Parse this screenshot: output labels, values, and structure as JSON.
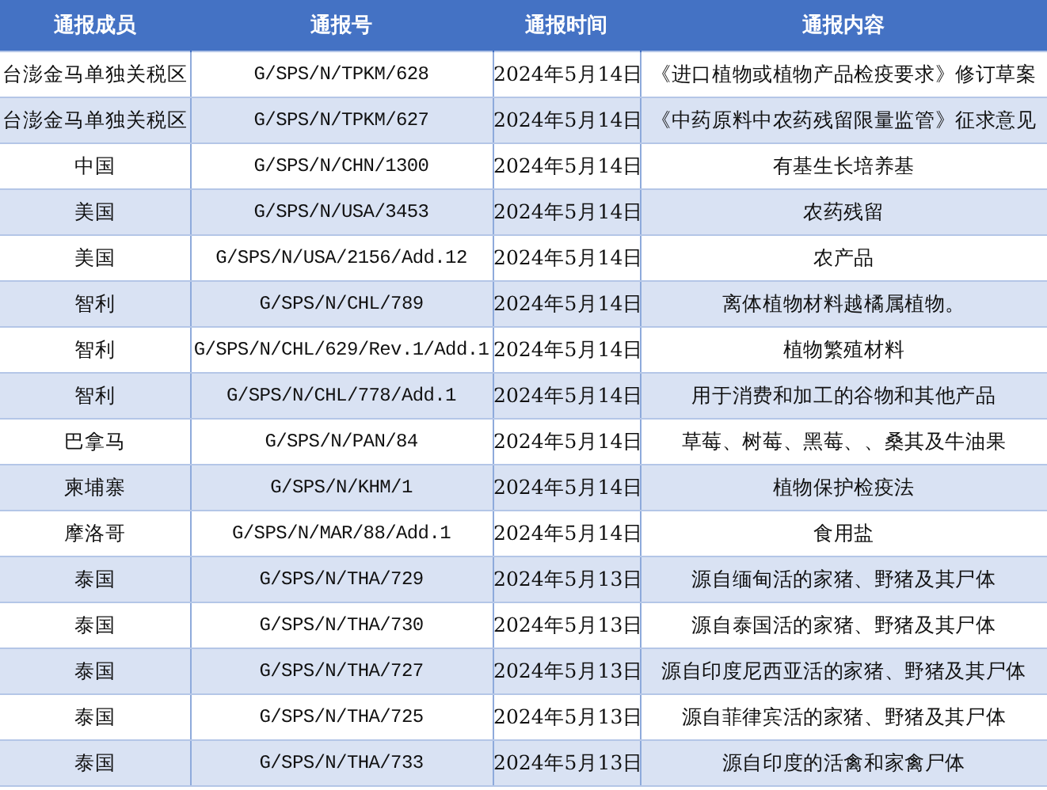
{
  "table": {
    "columns": [
      "通报成员",
      "通报号",
      "通报时间",
      "通报内容"
    ],
    "rows": [
      [
        "台澎金马单独关税区",
        "G/SPS/N/TPKM/628",
        "2024年5月14日",
        "《进口植物或植物产品检疫要求》修订草案"
      ],
      [
        "台澎金马单独关税区",
        "G/SPS/N/TPKM/627",
        "2024年5月14日",
        "《中药原料中农药残留限量监管》征求意见"
      ],
      [
        "中国",
        "G/SPS/N/CHN/1300",
        "2024年5月14日",
        "有基生长培养基"
      ],
      [
        "美国",
        "G/SPS/N/USA/3453",
        "2024年5月14日",
        "农药残留"
      ],
      [
        "美国",
        "G/SPS/N/USA/2156/Add.12",
        "2024年5月14日",
        "农产品"
      ],
      [
        "智利",
        "G/SPS/N/CHL/789",
        "2024年5月14日",
        "离体植物材料越橘属植物。"
      ],
      [
        "智利",
        "G/SPS/N/CHL/629/Rev.1/Add.1",
        "2024年5月14日",
        "植物繁殖材料"
      ],
      [
        "智利",
        "G/SPS/N/CHL/778/Add.1",
        "2024年5月14日",
        "用于消费和加工的谷物和其他产品"
      ],
      [
        "巴拿马",
        "G/SPS/N/PAN/84",
        "2024年5月14日",
        "草莓、树莓、黑莓、、桑其及牛油果"
      ],
      [
        "柬埔寨",
        "G/SPS/N/KHM/1",
        "2024年5月14日",
        "植物保护检疫法"
      ],
      [
        "摩洛哥",
        "G/SPS/N/MAR/88/Add.1",
        "2024年5月14日",
        "食用盐"
      ],
      [
        "泰国",
        "G/SPS/N/THA/729",
        "2024年5月13日",
        "源自缅甸活的家猪、野猪及其尸体"
      ],
      [
        "泰国",
        "G/SPS/N/THA/730",
        "2024年5月13日",
        "源自泰国活的家猪、野猪及其尸体"
      ],
      [
        "泰国",
        "G/SPS/N/THA/727",
        "2024年5月13日",
        "源自印度尼西亚活的家猪、野猪及其尸体"
      ],
      [
        "泰国",
        "G/SPS/N/THA/725",
        "2024年5月13日",
        "源自菲律宾活的家猪、野猪及其尸体"
      ],
      [
        "泰国",
        "G/SPS/N/THA/733",
        "2024年5月13日",
        "源自印度的活禽和家禽尸体"
      ]
    ]
  }
}
